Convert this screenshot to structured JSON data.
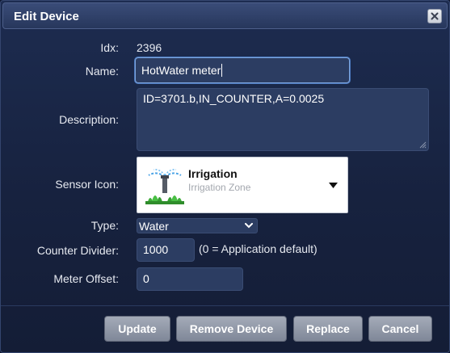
{
  "dialog": {
    "title": "Edit Device",
    "close_icon": "close-icon"
  },
  "form": {
    "idx": {
      "label": "Idx:",
      "value": "2396"
    },
    "name": {
      "label": "Name:",
      "value": "HotWater meter"
    },
    "description": {
      "label": "Description:",
      "value": "ID=3701.b,IN_COUNTER,A=0.0025"
    },
    "sensor_icon": {
      "label": "Sensor Icon:",
      "selected_title": "Irrigation",
      "selected_subtitle": "Irrigation Zone",
      "icon": "irrigation-sprinkler-icon"
    },
    "type": {
      "label": "Type:",
      "value": "Water"
    },
    "counter_divider": {
      "label": "Counter Divider:",
      "value": "1000",
      "hint": "(0 = Application default)"
    },
    "meter_offset": {
      "label": "Meter Offset:",
      "value": "0"
    }
  },
  "buttons": {
    "update": "Update",
    "remove": "Remove Device",
    "replace": "Replace",
    "cancel": "Cancel"
  },
  "colors": {
    "background": "#17223f",
    "field": "#2c3d62",
    "focus_border": "#7da5de",
    "button": "#8e96a6"
  }
}
